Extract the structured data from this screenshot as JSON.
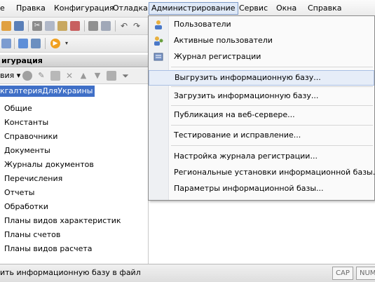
{
  "menubar": {
    "items": [
      "е",
      "Правка",
      "Конфигурация",
      "Отладка",
      "Администрирование",
      "Сервис",
      "Окна",
      "Справка"
    ]
  },
  "panel": {
    "header": "игурация",
    "toolbar_label": "вия ▾"
  },
  "tree": {
    "root": "кгалтерияДляУкраины",
    "items": [
      "Общие",
      "Константы",
      "Справочники",
      "Документы",
      "Журналы документов",
      "Перечисления",
      "Отчеты",
      "Обработки",
      "Планы видов характеристик",
      "Планы счетов",
      "Планы видов расчета"
    ]
  },
  "dropdown": {
    "items": [
      {
        "label": "Пользователи",
        "icon": "users-icon"
      },
      {
        "label": "Активные пользователи",
        "icon": "active-users-icon"
      },
      {
        "label": "Журнал регистрации",
        "icon": "log-icon"
      },
      {
        "label": "Выгрузить информационную базу...",
        "icon": ""
      },
      {
        "label": "Загрузить информационную базу...",
        "icon": ""
      },
      {
        "label": "Публикация на веб-сервере...",
        "icon": ""
      },
      {
        "label": "Тестирование и исправление...",
        "icon": ""
      },
      {
        "label": "Настройка журнала регистрации...",
        "icon": ""
      },
      {
        "label": "Региональные установки информационной базы...",
        "icon": ""
      },
      {
        "label": "Параметры информационной базы...",
        "icon": ""
      }
    ]
  },
  "statusbar": {
    "text": "ить информационную базу в файл",
    "cap": "CAP",
    "num": "NUM"
  },
  "colors": {
    "selection": "#3f6fc7",
    "highlight": "#e6edf8",
    "menu_active": "#dfe9f7"
  }
}
